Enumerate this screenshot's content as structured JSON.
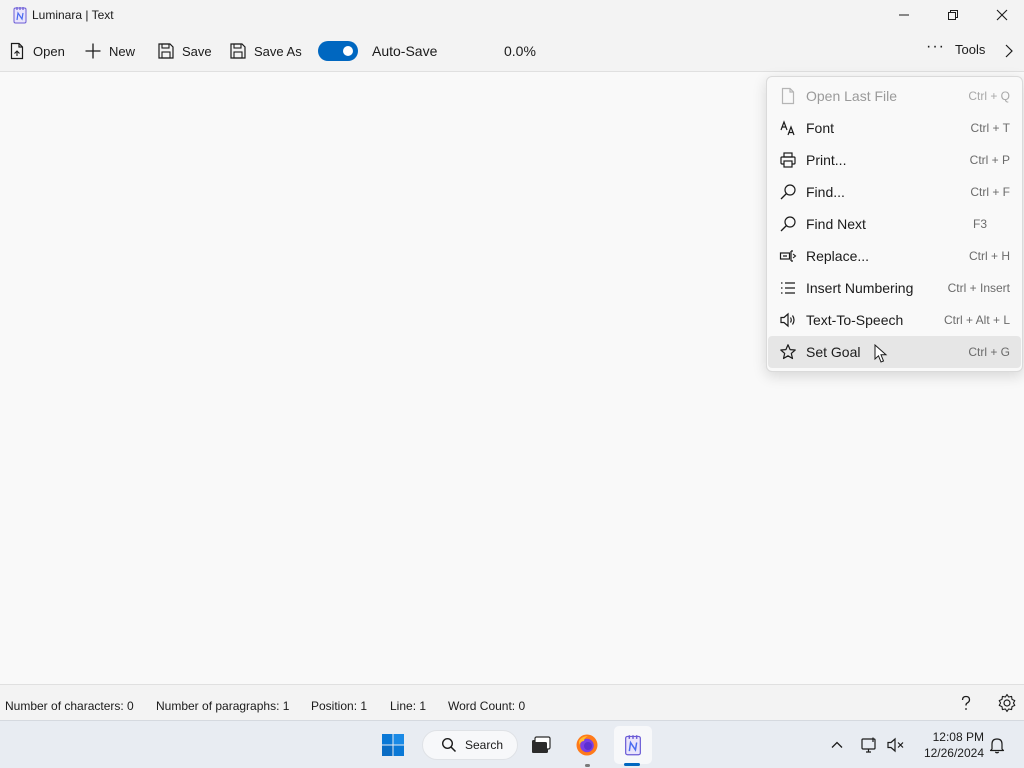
{
  "window": {
    "title": "Luminara | Text",
    "icons": {
      "app": "notepad-app-icon",
      "minimize": "minimize-icon",
      "restore": "restore-icon",
      "close": "close-icon"
    }
  },
  "toolbar": {
    "open_label": "Open",
    "new_label": "New",
    "save_label": "Save",
    "save_as_label": "Save As",
    "autosave_label": "Auto-Save",
    "autosave_on": true,
    "progress": "0.0%",
    "tools_label": "Tools",
    "accent": "#0067c0"
  },
  "menu": {
    "items": [
      {
        "label": "Open Last File",
        "shortcut": "Ctrl + Q",
        "icon": "open-file-icon",
        "disabled": true
      },
      {
        "label": "Font",
        "shortcut": "Ctrl + T",
        "icon": "font-icon",
        "disabled": false
      },
      {
        "label": "Print...",
        "shortcut": "Ctrl + P",
        "icon": "printer-icon",
        "disabled": false
      },
      {
        "label": "Find...",
        "shortcut": "Ctrl + F",
        "icon": "search-icon",
        "disabled": false
      },
      {
        "label": "Find Next",
        "shortcut": "F3",
        "icon": "search-icon",
        "disabled": false
      },
      {
        "label": "Replace...",
        "shortcut": "Ctrl + H",
        "icon": "replace-icon",
        "disabled": false
      },
      {
        "label": "Insert Numbering",
        "shortcut": "Ctrl + Insert",
        "icon": "list-icon",
        "disabled": false
      },
      {
        "label": "Text-To-Speech",
        "shortcut": "Ctrl + Alt + L",
        "icon": "speaker-icon",
        "disabled": false
      },
      {
        "label": "Set Goal",
        "shortcut": "Ctrl + G",
        "icon": "star-icon",
        "disabled": false,
        "hovered": true
      }
    ]
  },
  "status": {
    "characters": "Number of characters: 0",
    "paragraphs": "Number of paragraphs: 1",
    "position": "Position: 1",
    "line": "Line: 1",
    "word_count": "Word Count: 0",
    "icons": {
      "help": "help-icon",
      "settings": "gear-icon"
    }
  },
  "taskbar": {
    "search_label": "Search",
    "time": "12:08 PM",
    "date": "12/26/2024",
    "icons": [
      "windows-start-icon",
      "search-icon",
      "task-view-icon",
      "firefox-icon",
      "notepad-app-icon",
      "chevron-up-icon",
      "network-icon",
      "volume-muted-icon",
      "notification-bell-icon"
    ]
  }
}
